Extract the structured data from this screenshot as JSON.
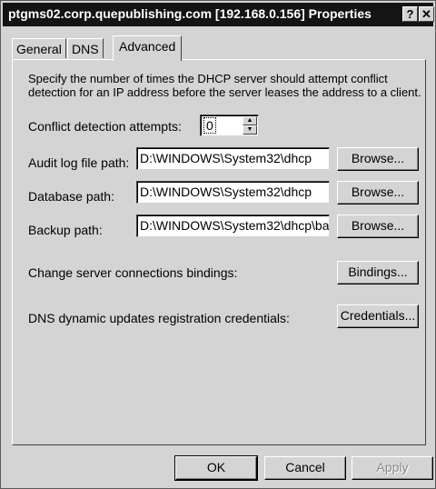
{
  "window": {
    "title": "ptgms02.corp.quepublishing.com [192.168.0.156] Properties",
    "help_glyph": "?",
    "close_glyph": "✕"
  },
  "tabs": [
    {
      "label": "General"
    },
    {
      "label": "DNS"
    },
    {
      "label": "Advanced",
      "active": true
    }
  ],
  "advanced": {
    "description": "Specify the number of times the DHCP server should attempt conflict detection for an IP address before the server leases the address to a client.",
    "conflict_label": "Conflict detection attempts:",
    "conflict_value": "0",
    "audit_label": "Audit log file path:",
    "audit_value": "D:\\WINDOWS\\System32\\dhcp",
    "database_label": "Database path:",
    "database_value": "D:\\WINDOWS\\System32\\dhcp",
    "backup_label": "Backup path:",
    "backup_value": "D:\\WINDOWS\\System32\\dhcp\\ba",
    "browse_label": "Browse...",
    "bindings_text": "Change server connections bindings:",
    "bindings_button": "Bindings...",
    "credentials_text": "DNS dynamic updates registration credentials:",
    "credentials_button": "Credentials..."
  },
  "footer": {
    "ok": "OK",
    "cancel": "Cancel",
    "apply": "Apply"
  }
}
